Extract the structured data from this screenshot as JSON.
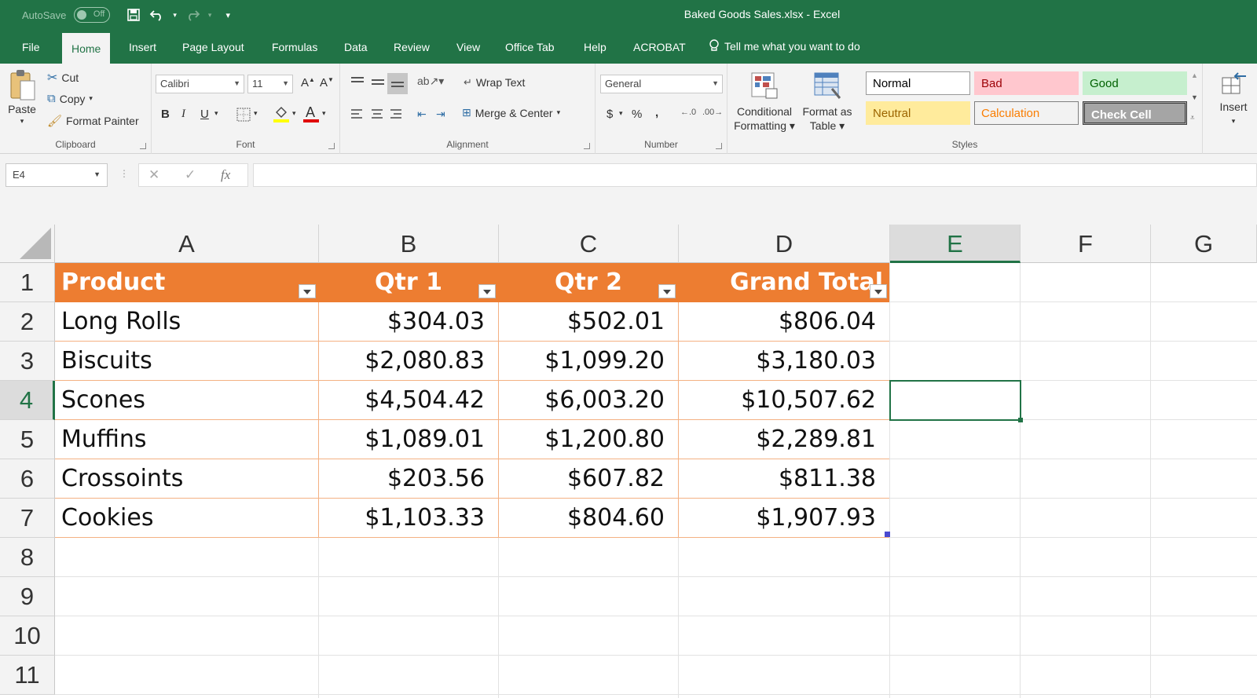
{
  "titlebar": {
    "autosave_label": "AutoSave",
    "autosave_state": "Off",
    "doc_title": "Baked Goods Sales.xlsx  -  Excel"
  },
  "tabs": [
    "File",
    "Home",
    "Insert",
    "Page Layout",
    "Formulas",
    "Data",
    "Review",
    "View",
    "Office Tab",
    "Help",
    "ACROBAT"
  ],
  "active_tab": "Home",
  "tell_me": "Tell me what you want to do",
  "clipboard": {
    "group_label": "Clipboard",
    "paste": "Paste",
    "cut": "Cut",
    "copy": "Copy",
    "format_painter": "Format Painter"
  },
  "font": {
    "group_label": "Font",
    "font_name": "Calibri",
    "font_size": "11",
    "bold": "B",
    "italic": "I",
    "underline": "U"
  },
  "alignment": {
    "group_label": "Alignment",
    "wrap_text": "Wrap Text",
    "merge_center": "Merge & Center"
  },
  "number": {
    "group_label": "Number",
    "format": "General",
    "currency": "$",
    "percent": "%",
    "comma": ","
  },
  "styles": {
    "group_label": "Styles",
    "conditional_formatting": "Conditional Formatting",
    "format_as_table": "Format as Table",
    "normal": "Normal",
    "bad": "Bad",
    "good": "Good",
    "neutral": "Neutral",
    "calculation": "Calculation",
    "check_cell": "Check Cell"
  },
  "cells_group": {
    "insert": "Insert"
  },
  "formula_bar": {
    "name_box": "E4",
    "fx": "fx",
    "content": ""
  },
  "columns": [
    "A",
    "B",
    "C",
    "D",
    "E",
    "F",
    "G"
  ],
  "selected_column": "E",
  "rows": [
    "1",
    "2",
    "3",
    "4",
    "5",
    "6",
    "7",
    "8",
    "9",
    "10",
    "11"
  ],
  "selected_row": "4",
  "table": {
    "headers": [
      "Product",
      "Qtr 1",
      "Qtr 2",
      "Grand Total"
    ],
    "rows": [
      [
        "Long Rolls",
        "$304.03",
        "$502.01",
        "$806.04"
      ],
      [
        "Biscuits",
        "$2,080.83",
        "$1,099.20",
        "$3,180.03"
      ],
      [
        "Scones",
        "$4,504.42",
        "$6,003.20",
        "$10,507.62"
      ],
      [
        "Muffins",
        "$1,089.01",
        "$1,200.80",
        "$2,289.81"
      ],
      [
        "Crossoints",
        "$203.56",
        "$607.82",
        "$811.38"
      ],
      [
        "Cookies",
        "$1,103.33",
        "$804.60",
        "$1,907.93"
      ]
    ]
  },
  "colors": {
    "excel_green": "#217346",
    "table_header": "#ed7d31",
    "table_border": "#f4b183"
  }
}
